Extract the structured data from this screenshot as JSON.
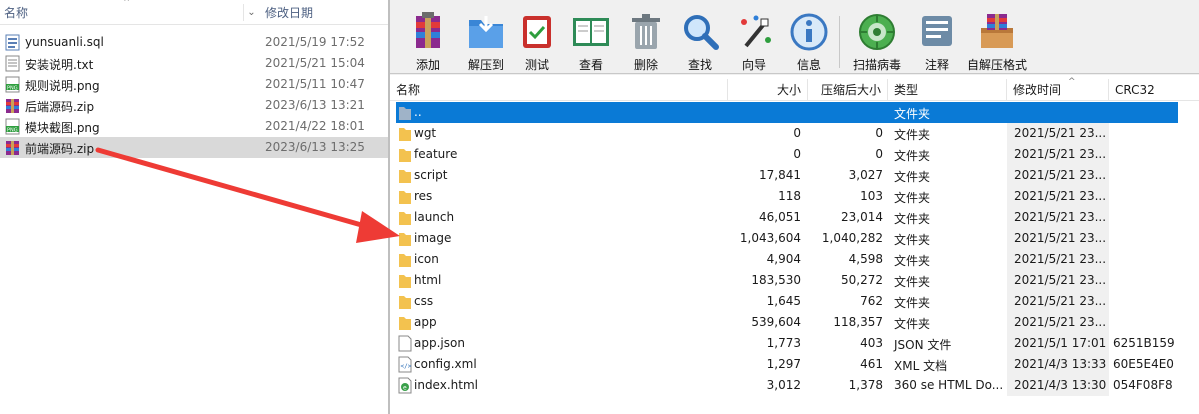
{
  "explorer": {
    "header": {
      "name_label": "名称",
      "date_label": "修改日期",
      "collapse_caret": "⌃",
      "sort_caret": "⌄"
    },
    "files": [
      {
        "name": "yunsuanli.sql",
        "date": "2021/5/19 17:52",
        "icon": "sql-file-icon",
        "selected": false
      },
      {
        "name": "安装说明.txt",
        "date": "2021/5/21 15:04",
        "icon": "text-file-icon",
        "selected": false
      },
      {
        "name": "规则说明.png",
        "date": "2021/5/11 10:47",
        "icon": "png-file-icon",
        "selected": false
      },
      {
        "name": "后端源码.zip",
        "date": "2023/6/13 13:21",
        "icon": "zip-file-icon",
        "selected": false
      },
      {
        "name": "模块截图.png",
        "date": "2021/4/22 18:01",
        "icon": "png-file-icon",
        "selected": false
      },
      {
        "name": "前端源码.zip",
        "date": "2023/6/13 13:25",
        "icon": "zip-file-icon",
        "selected": true
      }
    ]
  },
  "toolbar": {
    "items": [
      {
        "label": "添加",
        "icon": "add-archive-icon"
      },
      {
        "label": "解压到",
        "icon": "extract-to-icon"
      },
      {
        "label": "测试",
        "icon": "test-icon"
      },
      {
        "label": "查看",
        "icon": "view-icon"
      },
      {
        "label": "删除",
        "icon": "delete-icon"
      },
      {
        "label": "查找",
        "icon": "find-icon"
      },
      {
        "label": "向导",
        "icon": "wizard-icon"
      },
      {
        "label": "信息",
        "icon": "info-icon"
      },
      {
        "label": "扫描病毒",
        "icon": "virus-scan-icon"
      },
      {
        "label": "注释",
        "icon": "comment-icon"
      },
      {
        "label": "自解压格式",
        "icon": "sfx-icon"
      }
    ]
  },
  "list": {
    "columns": {
      "name": "名称",
      "size": "大小",
      "packed": "压缩后大小",
      "type": "类型",
      "modified": "修改时间",
      "crc": "CRC32"
    },
    "rows": [
      {
        "name": "..",
        "size": "",
        "packed": "",
        "type": "文件夹",
        "modified": "",
        "crc": "",
        "icon": "parent-folder-icon",
        "selected": true
      },
      {
        "name": "wgt",
        "size": "0",
        "packed": "0",
        "type": "文件夹",
        "modified": "2021/5/21 23...",
        "crc": "",
        "icon": "folder-icon",
        "selected": false
      },
      {
        "name": "feature",
        "size": "0",
        "packed": "0",
        "type": "文件夹",
        "modified": "2021/5/21 23...",
        "crc": "",
        "icon": "folder-icon",
        "selected": false
      },
      {
        "name": "script",
        "size": "17,841",
        "packed": "3,027",
        "type": "文件夹",
        "modified": "2021/5/21 23...",
        "crc": "",
        "icon": "folder-icon",
        "selected": false
      },
      {
        "name": "res",
        "size": "118",
        "packed": "103",
        "type": "文件夹",
        "modified": "2021/5/21 23...",
        "crc": "",
        "icon": "folder-icon",
        "selected": false
      },
      {
        "name": "launch",
        "size": "46,051",
        "packed": "23,014",
        "type": "文件夹",
        "modified": "2021/5/21 23...",
        "crc": "",
        "icon": "folder-icon",
        "selected": false
      },
      {
        "name": "image",
        "size": "1,043,604",
        "packed": "1,040,282",
        "type": "文件夹",
        "modified": "2021/5/21 23...",
        "crc": "",
        "icon": "folder-icon",
        "selected": false
      },
      {
        "name": "icon",
        "size": "4,904",
        "packed": "4,598",
        "type": "文件夹",
        "modified": "2021/5/21 23...",
        "crc": "",
        "icon": "folder-icon",
        "selected": false
      },
      {
        "name": "html",
        "size": "183,530",
        "packed": "50,272",
        "type": "文件夹",
        "modified": "2021/5/21 23...",
        "crc": "",
        "icon": "folder-icon",
        "selected": false
      },
      {
        "name": "css",
        "size": "1,645",
        "packed": "762",
        "type": "文件夹",
        "modified": "2021/5/21 23...",
        "crc": "",
        "icon": "folder-icon",
        "selected": false
      },
      {
        "name": "app",
        "size": "539,604",
        "packed": "118,357",
        "type": "文件夹",
        "modified": "2021/5/21 23...",
        "crc": "",
        "icon": "folder-icon",
        "selected": false
      },
      {
        "name": "app.json",
        "size": "1,773",
        "packed": "403",
        "type": "JSON 文件",
        "modified": "2021/5/1 17:01",
        "crc": "6251B159",
        "icon": "json-file-icon",
        "selected": false
      },
      {
        "name": "config.xml",
        "size": "1,297",
        "packed": "461",
        "type": "XML 文档",
        "modified": "2021/4/3 13:33",
        "crc": "60E5E4E0",
        "icon": "xml-file-icon",
        "selected": false
      },
      {
        "name": "index.html",
        "size": "3,012",
        "packed": "1,378",
        "type": "360 se HTML Do...",
        "modified": "2021/4/3 13:30",
        "crc": "054F08F8",
        "icon": "html-file-icon",
        "selected": false
      }
    ]
  },
  "colors": {
    "selection": "#0a7ad6",
    "folder": "#f3c24f",
    "arrow": "#ee3b35",
    "explorer_selection": "#d9d9d9"
  }
}
